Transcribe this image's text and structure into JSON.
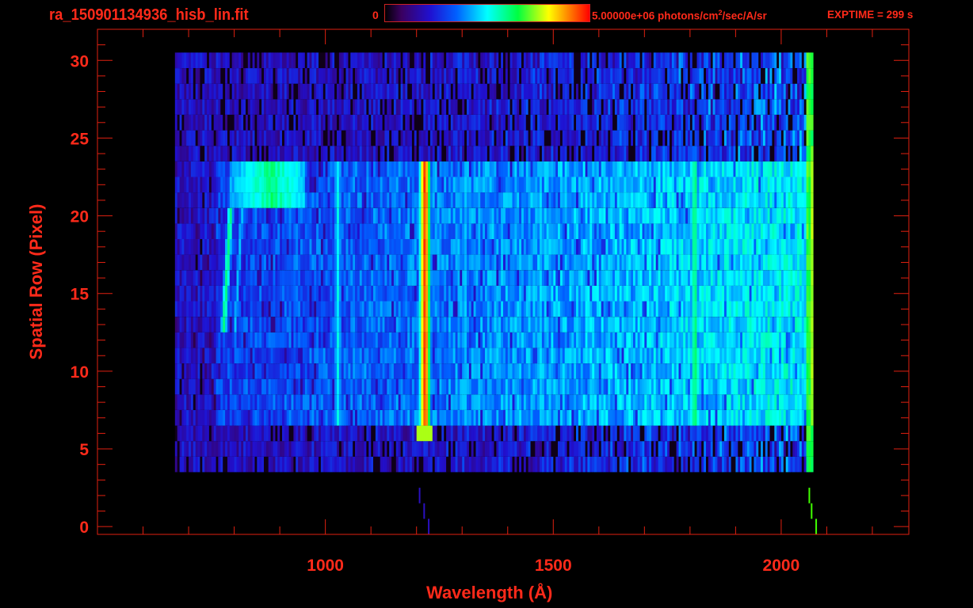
{
  "header": {
    "title": "ra_150901134936_hisb_lin.fit",
    "colorbar_min": "0",
    "colorbar_max": "5.00000e+06 photons/cm",
    "colorbar_unit_sup": "2",
    "colorbar_unit_rest": "/sec/A/sr",
    "exptime": "EXPTIME = 299 s"
  },
  "chart_data": {
    "type": "heatmap",
    "title": "ra_150901134936_hisb_lin.fit",
    "xlabel": "Wavelength (Å)",
    "ylabel": "Spatial Row (Pixel)",
    "xlim": [
      500,
      2280
    ],
    "ylim": [
      -0.5,
      32
    ],
    "xticks": [
      1000,
      1500,
      2000
    ],
    "xtick_labels": [
      "1000",
      "1500",
      "2000"
    ],
    "yticks": [
      0,
      5,
      10,
      15,
      20,
      25,
      30
    ],
    "ytick_labels": [
      "0",
      "5",
      "10",
      "15",
      "20",
      "25",
      "30"
    ],
    "colorbar": {
      "min": 0,
      "max": 5000000,
      "colormap": "rainbow"
    },
    "data_wavelength_range": [
      670,
      2070
    ],
    "data_rows": [
      4,
      30
    ],
    "signal_rows": [
      7,
      23
    ],
    "emission_lines": [
      {
        "wavelength": 1025,
        "strength": 0.5
      },
      {
        "wavelength": 1216,
        "strength": 0.95
      },
      {
        "wavelength": 1304,
        "strength": 0.45
      },
      {
        "wavelength": 1356,
        "strength": 0.38
      },
      {
        "wavelength": 1470,
        "strength": 0.45
      },
      {
        "wavelength": 1808,
        "strength": 0.62
      },
      {
        "wavelength": 2065,
        "strength": 0.75
      }
    ],
    "arc_feature": {
      "wavelength_range": [
        770,
        950
      ],
      "rows": [
        13,
        23
      ],
      "strength": 0.6
    }
  },
  "colors": {
    "axis": "#ff2a1a",
    "background": "#000000"
  }
}
